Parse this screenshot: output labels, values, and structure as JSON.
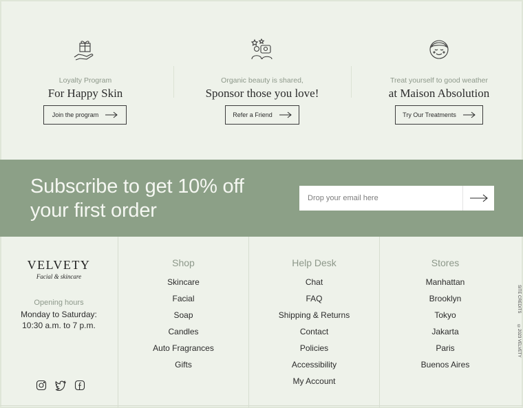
{
  "promos": [
    {
      "kicker": "Loyalty Program",
      "headline": "For Happy Skin",
      "button": "Join the program",
      "icon": "gift-hand-icon"
    },
    {
      "kicker": "Organic beauty is shared,",
      "headline": "Sponsor those you love!",
      "button": "Refer a Friend",
      "icon": "friends-stars-icon"
    },
    {
      "kicker": "Treat yourself to good weather",
      "headline": "at Maison Absolution",
      "button": "Try Our Treatments",
      "icon": "face-mask-icon"
    }
  ],
  "subscribe": {
    "title_line1": "Subscribe to get 10% off",
    "title_line2": "your first order",
    "placeholder": "Drop your email here",
    "band_color": "#8ca087"
  },
  "brand": {
    "logo": "VELVETY",
    "tagline": "Facial & skincare",
    "hours_label": "Opening hours",
    "hours_line1": "Monday to Saturday:",
    "hours_line2": "10:30 a.m. to 7 p.m.",
    "social": [
      "instagram-icon",
      "twitter-icon",
      "facebook-icon"
    ]
  },
  "shop": {
    "title": "Shop",
    "items": [
      "Skincare",
      "Facial",
      "Soap",
      "Candles",
      "Auto Fragrances",
      "Gifts"
    ]
  },
  "help": {
    "title": "Help Desk",
    "items": [
      "Chat",
      "FAQ",
      "Shipping & Returns",
      "Contact",
      "Policies",
      "Accessibility",
      "My Account"
    ]
  },
  "stores": {
    "title": "Stores",
    "items": [
      "Manhattan",
      "Brooklyn",
      "Tokyo",
      "Jakarta",
      "Paris",
      "Buenos Aires"
    ]
  },
  "side": {
    "credits": "SITE CREDITS",
    "copyright": "©2023 VELVETY"
  }
}
